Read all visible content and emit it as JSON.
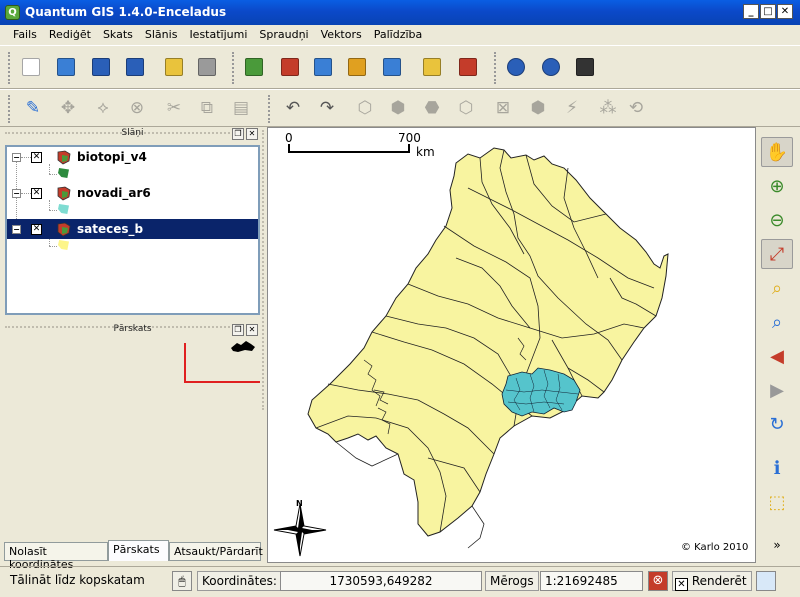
{
  "window": {
    "title": "Quantum GIS 1.4.0-Enceladus",
    "app_icon": "Q",
    "minimize": "_",
    "maximize": "□",
    "close": "✕"
  },
  "menu": [
    "Fails",
    "Rediģēt",
    "Skats",
    "Slānis",
    "Iestatījumi",
    "Spraudņi",
    "Vektors",
    "Palīdzība"
  ],
  "toolbar1": [
    {
      "name": "new-project-icon",
      "color": "#ffffff"
    },
    {
      "name": "open-project-icon",
      "color": "#3a7fd5"
    },
    {
      "name": "save-project-icon",
      "color": "#2a5fb8"
    },
    {
      "name": "save-as-icon",
      "color": "#2a5fb8"
    },
    {
      "name": "print-composer-star-icon",
      "color": "#e9c33c"
    },
    {
      "name": "print-icon",
      "color": "#9a9a9a"
    },
    {
      "name": "add-vector-layer-icon",
      "color": "#4a9a3a"
    },
    {
      "name": "add-raster-layer-icon",
      "color": "#c43c2a"
    },
    {
      "name": "add-postgis-layer-icon",
      "color": "#3a7fd5"
    },
    {
      "name": "add-spatialite-layer-icon",
      "color": "#e0a020"
    },
    {
      "name": "add-wms-layer-icon",
      "color": "#3a7fd5"
    },
    {
      "name": "new-vector-layer-icon",
      "color": "#e9c33c"
    },
    {
      "name": "remove-layer-icon",
      "color": "#c43c2a"
    },
    {
      "name": "copyright-label-icon",
      "color": "#2a5fb8"
    },
    {
      "name": "north-arrow-icon",
      "color": "#2a5fb8"
    },
    {
      "name": "scale-bar-icon",
      "color": "#333333"
    }
  ],
  "toolbar2": [
    {
      "name": "toggle-editing-pencil-icon",
      "dim": false
    },
    {
      "name": "move-feature-icon",
      "dim": true
    },
    {
      "name": "node-tool-icon",
      "dim": true
    },
    {
      "name": "delete-selected-icon",
      "dim": true
    },
    {
      "name": "cut-features-icon",
      "dim": true
    },
    {
      "name": "copy-features-icon",
      "dim": true
    },
    {
      "name": "paste-features-icon",
      "dim": true
    },
    {
      "name": "undo-icon",
      "dim": false
    },
    {
      "name": "redo-icon",
      "dim": false
    },
    {
      "name": "simplify-feature-icon",
      "dim": true
    },
    {
      "name": "add-ring-icon",
      "dim": true
    },
    {
      "name": "add-island-icon",
      "dim": true
    },
    {
      "name": "delete-ring-icon",
      "dim": true
    },
    {
      "name": "delete-part-icon",
      "dim": true
    },
    {
      "name": "reshape-features-icon",
      "dim": true
    },
    {
      "name": "split-features-icon",
      "dim": true
    },
    {
      "name": "merge-features-icon",
      "dim": true
    },
    {
      "name": "node-rotate-icon",
      "dim": true
    },
    {
      "name": "rotate-feature-icon",
      "dim": true
    }
  ],
  "layers_panel": {
    "title": "Slāņi",
    "float_btn": "❐",
    "close_btn": "✕"
  },
  "layers": [
    {
      "name": "biotopi_v4",
      "checked": "✕",
      "expand": "−",
      "symbol_color": "#2e8b3f",
      "selected": false
    },
    {
      "name": "novadi_ar6",
      "checked": "✕",
      "expand": "−",
      "symbol_color": "#7fdcd2",
      "selected": false
    },
    {
      "name": "sateces_b",
      "checked": "✕",
      "expand": "−",
      "symbol_color": "#fdf589",
      "selected": true
    }
  ],
  "overview_panel": {
    "title": "Pārskats",
    "float_btn": "❐",
    "close_btn": "✕"
  },
  "tabs": [
    "Nolasīt koordinātes",
    "Pārskats",
    "Atsaukt/Pārdarīt"
  ],
  "map": {
    "scale_bar": {
      "left": "0",
      "right": "700",
      "unit": "km"
    },
    "north_label": "N",
    "copyright": "© Karlo 2010",
    "fill": "#f8f4a0",
    "highlight": "#55c4cc"
  },
  "right_toolbar": [
    {
      "name": "pan-hand-icon",
      "selected": true
    },
    {
      "name": "zoom-in-icon",
      "selected": false
    },
    {
      "name": "zoom-out-icon",
      "selected": false
    },
    {
      "name": "zoom-full-icon",
      "selected": true
    },
    {
      "name": "zoom-selection-icon",
      "selected": false
    },
    {
      "name": "zoom-layer-icon",
      "selected": false
    },
    {
      "name": "zoom-last-icon",
      "selected": false
    },
    {
      "name": "zoom-next-icon",
      "selected": false
    },
    {
      "name": "refresh-icon",
      "selected": false
    },
    {
      "name": "identify-icon",
      "selected": false
    },
    {
      "name": "select-features-icon",
      "selected": false
    },
    {
      "name": "more-chevron-icon",
      "selected": false
    }
  ],
  "statusbar": {
    "message": "Tālināt līdz kopskatam",
    "coords_label": "Koordinātes:",
    "coords_value": "1730593,649282",
    "scale_label": "Mērogs",
    "scale_value": "1:21692485",
    "render_label": "Renderēt",
    "render_check": "✕",
    "stop_icon": "⊗"
  }
}
